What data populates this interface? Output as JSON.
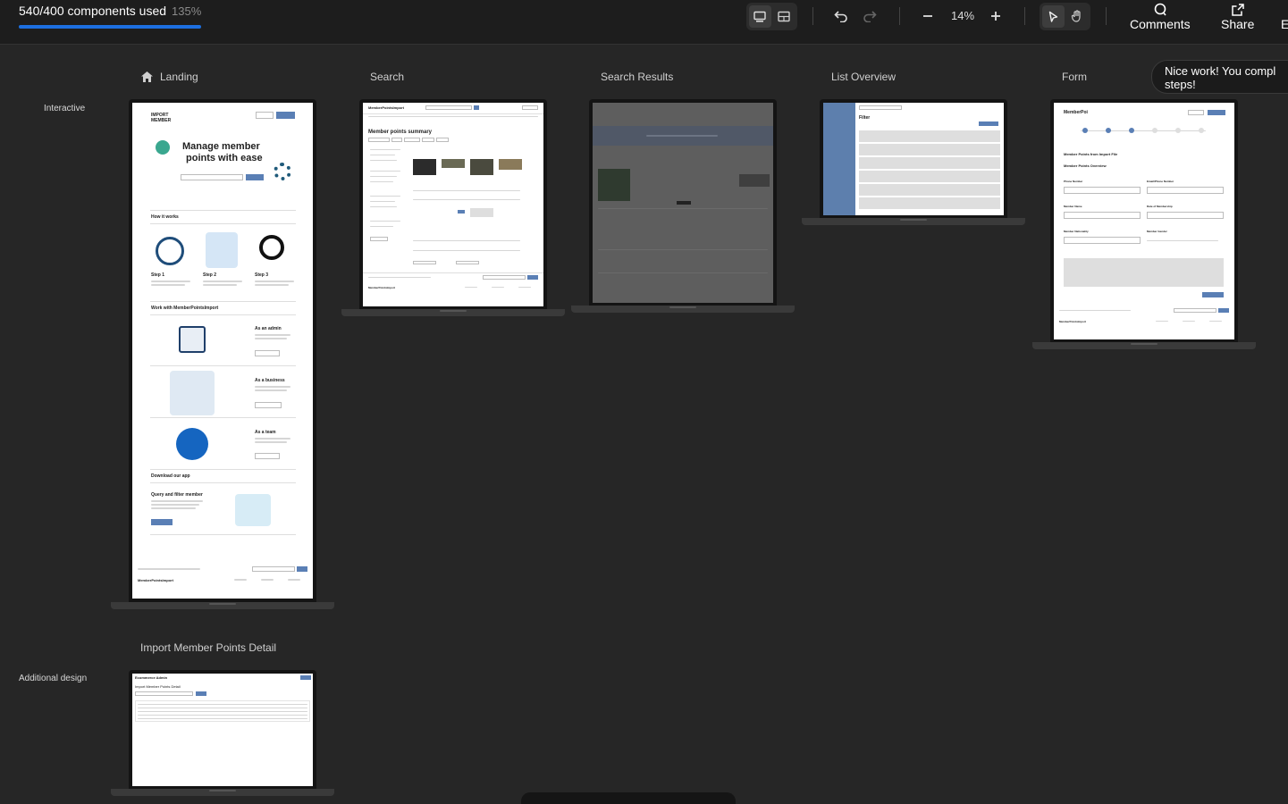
{
  "usage": {
    "text": "540/400 components used",
    "percent_text": "135%",
    "fill": 1.0
  },
  "toolbar": {
    "zoom": "14%",
    "comments_label": "Comments",
    "share_label": "Share",
    "cut_label": "E"
  },
  "rows": {
    "interactive": "Interactive",
    "additional": "Additional design"
  },
  "frames": {
    "landing": "Landing",
    "search": "Search",
    "search_results": "Search Results",
    "list_overview": "List Overview",
    "form": "Form",
    "import_detail": "Import Member Points Detail"
  },
  "toast": {
    "line1": "Nice work! You compl",
    "line2": "steps!"
  },
  "mini": {
    "landing": {
      "logo1": "IMPORT",
      "logo2": "MEMBER",
      "hero1": "Manage member",
      "hero2": "points with ease",
      "how": "How it works",
      "step1": "Step 1",
      "step2": "Step 2",
      "step3": "Step 3",
      "work": "Work with MemberPointsImport",
      "admin": "As an admin",
      "business": "As a business",
      "team": "As a team",
      "download": "Download our app",
      "query": "Query and filter member",
      "footer": "MemberPointsImport"
    },
    "search": {
      "brand": "MemberPointsImport",
      "title": "Member points summary"
    },
    "list": {
      "filter": "Filter"
    },
    "form": {
      "brand": "MemberPoi",
      "heading": "Member Points from Import File",
      "sub": "Member Points Overview",
      "f1": "Phone Number",
      "f2": "Email/Phone Number",
      "f3": "Member Name",
      "f4": "Date of Membership",
      "f5": "Member Nationality",
      "f6": "Member Gender",
      "footer": "MemberPointsImport"
    },
    "detail": {
      "brand": "Ecommerce Admin",
      "title": "Import Member Points Detail"
    }
  },
  "colors": {
    "accent": "#1d6fe0",
    "brand_blue": "#5a7fb5",
    "canvas": "#262626"
  },
  "icons": [
    "layout-icon",
    "split-layout-icon",
    "undo-icon",
    "redo-icon",
    "zoom-out-icon",
    "zoom-in-icon",
    "pointer-icon",
    "hand-icon",
    "comment-icon",
    "share-icon",
    "home-icon"
  ]
}
